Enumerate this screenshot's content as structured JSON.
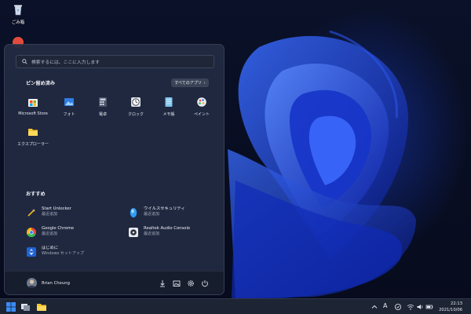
{
  "desktop": {
    "icons": [
      {
        "label": "ごみ箱"
      }
    ]
  },
  "start_menu": {
    "search_placeholder": "検索するには、ここに入力します",
    "pinned": {
      "title": "ピン留め済み",
      "all_apps_label": "すべてのアプリ",
      "apps": [
        {
          "label": "Microsoft Store",
          "icon": "store-icon"
        },
        {
          "label": "フォト",
          "icon": "photos-icon"
        },
        {
          "label": "電卓",
          "icon": "calculator-icon"
        },
        {
          "label": "クロック",
          "icon": "clock-icon"
        },
        {
          "label": "メモ帳",
          "icon": "notepad-icon"
        },
        {
          "label": "ペイント",
          "icon": "paint-icon"
        },
        {
          "label": "エクスプローラー",
          "icon": "folder-icon"
        }
      ]
    },
    "recommended": {
      "title": "おすすめ",
      "items": [
        {
          "name": "Start Unlocker",
          "sub": "最近追加",
          "icon": "wand-icon"
        },
        {
          "name": "ウイルスセキュリティ",
          "sub": "最近追加",
          "icon": "shield-icon"
        },
        {
          "name": "Google Chrome",
          "sub": "最近追加",
          "icon": "chrome-icon"
        },
        {
          "name": "Realtek Audio Console",
          "sub": "最近追加",
          "icon": "audio-icon"
        },
        {
          "name": "はじめに",
          "sub": "Windows セットアップ",
          "icon": "getstarted-icon"
        }
      ]
    },
    "user": {
      "name": "Brian Cheung"
    }
  },
  "taskbar": {
    "ime": "A",
    "time": "22:13",
    "date": "2021/10/06"
  },
  "colors": {
    "accent": "#2b6ef0",
    "start_bg": "#222a42",
    "taskbar_bg": "#1d2434"
  }
}
